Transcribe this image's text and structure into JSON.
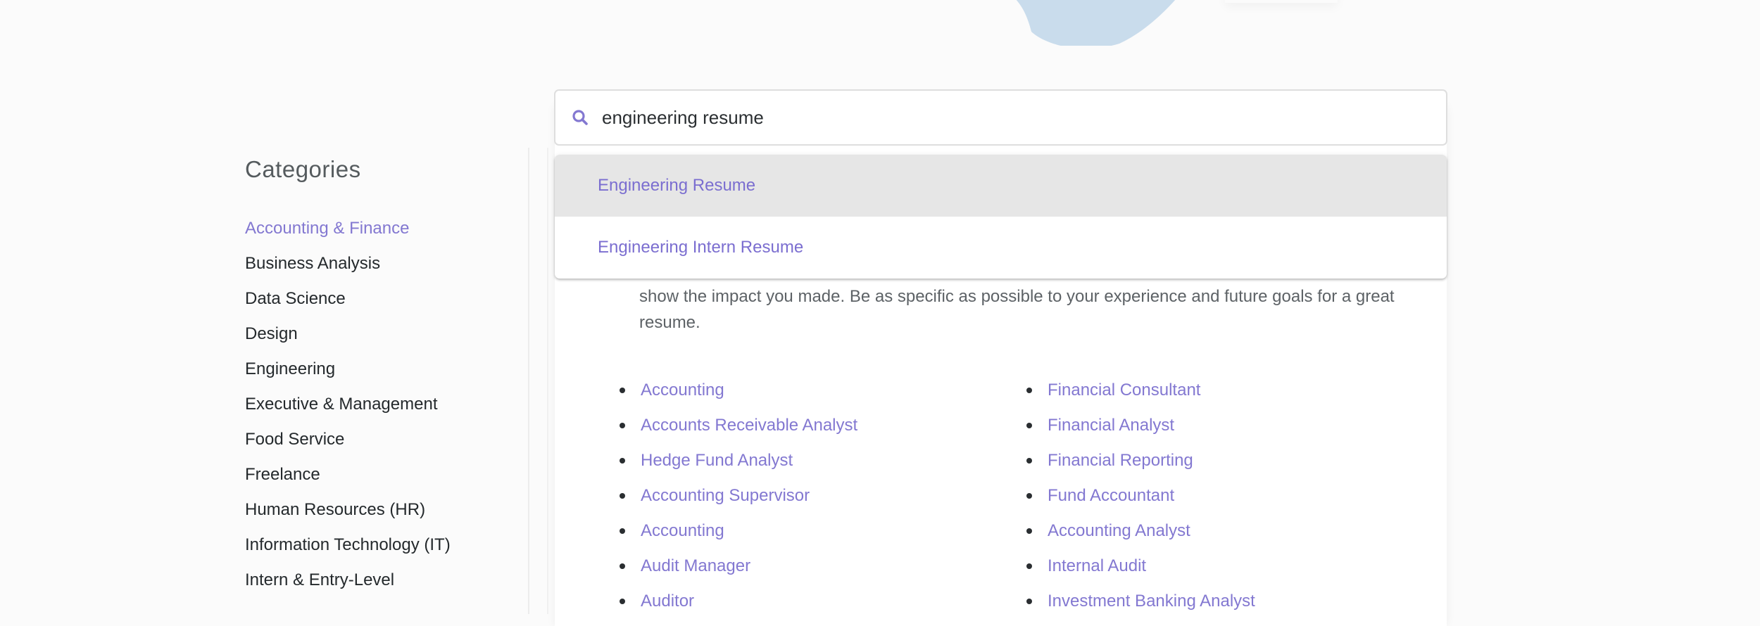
{
  "colors": {
    "accent": "#8378d1",
    "blob": "#c9dcec",
    "highlight": "#e6e6e6"
  },
  "search": {
    "icon": "search-icon",
    "value": "engineering resume",
    "suggestions": [
      {
        "label": "Engineering Resume",
        "highlighted": true
      },
      {
        "label": "Engineering Intern Resume",
        "highlighted": false
      }
    ]
  },
  "sidebar": {
    "title": "Categories",
    "items": [
      {
        "label": "Accounting & Finance",
        "active": true
      },
      {
        "label": "Business Analysis",
        "active": false
      },
      {
        "label": "Data Science",
        "active": false
      },
      {
        "label": "Design",
        "active": false
      },
      {
        "label": "Engineering",
        "active": false
      },
      {
        "label": "Executive & Management",
        "active": false
      },
      {
        "label": "Food Service",
        "active": false
      },
      {
        "label": "Freelance",
        "active": false
      },
      {
        "label": "Human Resources (HR)",
        "active": false
      },
      {
        "label": "Information Technology (IT)",
        "active": false
      },
      {
        "label": "Intern & Entry-Level",
        "active": false
      }
    ]
  },
  "main": {
    "intro_line_1": "show the impact you made. Be as specific as possible to your experience and future goals for a great",
    "intro_line_2": "resume.",
    "links_left": [
      "Accounting",
      "Accounts Receivable Analyst",
      "Hedge Fund Analyst",
      "Accounting Supervisor",
      "Accounting",
      "Audit Manager",
      "Auditor"
    ],
    "links_right": [
      "Financial Consultant",
      "Financial Analyst",
      "Financial Reporting",
      "Fund Accountant",
      "Accounting Analyst",
      "Internal Audit",
      "Investment Banking Analyst"
    ]
  }
}
